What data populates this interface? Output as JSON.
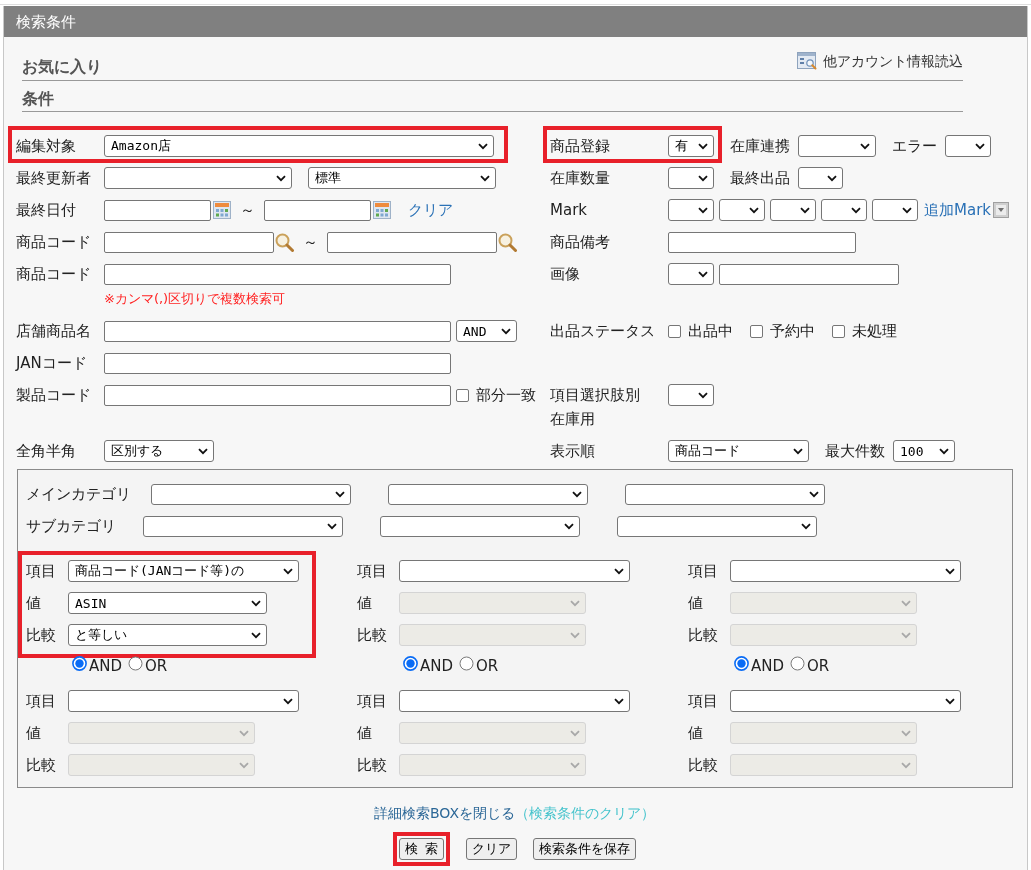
{
  "header": {
    "title": "検索条件"
  },
  "favorites": {
    "heading": "お気に入り",
    "link": "他アカウント情報読込"
  },
  "conditions": {
    "heading": "条件"
  },
  "form_rows": [
    {
      "left": [
        {
          "label": "編集対象",
          "highlighted": true,
          "controls": [
            {
              "kind": "select",
              "value": "Amazon店"
            }
          ]
        }
      ],
      "right": [
        {
          "label": "商品登録",
          "highlighted": true,
          "controls": [
            {
              "kind": "select",
              "value": "有"
            }
          ]
        },
        {
          "label": "在庫連携",
          "highlighted": false,
          "controls": [
            {
              "kind": "select"
            }
          ]
        },
        {
          "label": "エラー",
          "highlighted": false,
          "controls": [
            {
              "kind": "select"
            }
          ]
        }
      ]
    },
    {
      "left": [
        {
          "label": "最終更新者",
          "highlighted": false,
          "controls": [
            {
              "kind": "select"
            },
            {
              "kind": "select",
              "value": "標準"
            }
          ]
        }
      ],
      "right": [
        {
          "label": "在庫数量",
          "highlighted": false,
          "controls": [
            {
              "kind": "select"
            }
          ]
        },
        {
          "label": "最終出品",
          "highlighted": false,
          "controls": [
            {
              "kind": "select"
            }
          ]
        }
      ]
    },
    {
      "left": [
        {
          "label": "最終日付",
          "highlighted": false,
          "controls": [
            {
              "kind": "date"
            },
            {
              "kind": "text",
              "text": "～"
            },
            {
              "kind": "date"
            },
            {
              "kind": "link",
              "text": "クリア"
            }
          ]
        }
      ],
      "right": [
        {
          "label": "Mark",
          "highlighted": false,
          "controls": [
            {
              "kind": "select"
            },
            {
              "kind": "select"
            },
            {
              "kind": "select"
            },
            {
              "kind": "select"
            },
            {
              "kind": "select"
            },
            {
              "kind": "menu_link",
              "text": "追加Mark"
            }
          ]
        }
      ]
    },
    {
      "left": [
        {
          "label": "商品コード",
          "highlighted": false,
          "controls": [
            {
              "kind": "lookup"
            },
            {
              "kind": "text",
              "text": "～"
            },
            {
              "kind": "lookup"
            }
          ]
        }
      ],
      "right": [
        {
          "label": "商品備考",
          "highlighted": false,
          "controls": [
            {
              "kind": "input"
            }
          ]
        }
      ]
    },
    {
      "left": [
        {
          "label": "商品コード",
          "highlighted": false,
          "controls": [
            {
              "kind": "input"
            }
          ],
          "note": "※カンマ(,)区切りで複数検索可"
        }
      ],
      "right": [
        {
          "label": "画像",
          "highlighted": false,
          "controls": [
            {
              "kind": "select"
            },
            {
              "kind": "input"
            }
          ]
        }
      ]
    },
    {
      "left": [
        {
          "label": "店舗商品名",
          "highlighted": false,
          "controls": [
            {
              "kind": "input"
            },
            {
              "kind": "select",
              "value": "AND"
            }
          ]
        }
      ],
      "right": [
        {
          "label": "出品ステータス",
          "highlighted": false,
          "controls": [
            {
              "kind": "checkbox",
              "label": "出品中",
              "checked": false
            },
            {
              "kind": "checkbox",
              "label": "予約中",
              "checked": false
            },
            {
              "kind": "checkbox",
              "label": "未処理",
              "checked": false
            }
          ]
        }
      ]
    },
    {
      "left": [
        {
          "label": "JANコード",
          "highlighted": false,
          "controls": [
            {
              "kind": "input"
            }
          ]
        }
      ]
    },
    {
      "left": [
        {
          "label": "製品コード",
          "highlighted": false,
          "controls": [
            {
              "kind": "input"
            },
            {
              "kind": "checkbox",
              "label": "部分一致",
              "checked": false
            }
          ]
        }
      ],
      "right": [
        {
          "label": "項目選択肢別",
          "label_line_2": "在庫用",
          "highlighted": false,
          "controls": [
            {
              "kind": "select"
            }
          ]
        }
      ]
    },
    {
      "left": [
        {
          "label": "全角半角",
          "highlighted": false,
          "controls": [
            {
              "kind": "select",
              "value": "区別する"
            }
          ]
        }
      ],
      "right": [
        {
          "label": "表示順",
          "highlighted": false,
          "controls": [
            {
              "kind": "select",
              "value": "商品コード"
            }
          ]
        },
        {
          "label": "最大件数",
          "highlighted": false,
          "controls": [
            {
              "kind": "select",
              "value": "100"
            }
          ]
        }
      ]
    }
  ],
  "category_box": {
    "rows": [
      {
        "label": "メインカテゴリ",
        "selects": [
          {
            "disabled": false
          },
          {
            "disabled": false
          },
          {
            "disabled": false
          }
        ]
      },
      {
        "label": "サブカテゴリ",
        "selects": [
          {
            "disabled": false
          },
          {
            "disabled": false
          },
          {
            "disabled": false
          }
        ]
      }
    ],
    "condition_groups": [
      {
        "highlighted": true,
        "fields": [
          {
            "label": "項目",
            "value": "商品コード(JANコード等)の",
            "disabled": false
          },
          {
            "label": "値",
            "value": "ASIN",
            "disabled": false
          },
          {
            "label": "比較",
            "value": "と等しい",
            "disabled": false
          }
        ],
        "connector": [
          {
            "label": "AND",
            "selected": true
          },
          {
            "label": "OR",
            "selected": false
          }
        ]
      },
      {
        "highlighted": false,
        "fields": [
          {
            "label": "項目",
            "disabled": false
          },
          {
            "label": "値",
            "disabled": true
          },
          {
            "label": "比較",
            "disabled": true
          }
        ],
        "connector": [
          {
            "label": "AND",
            "selected": true
          },
          {
            "label": "OR",
            "selected": false
          }
        ]
      },
      {
        "highlighted": false,
        "fields": [
          {
            "label": "項目",
            "disabled": false
          },
          {
            "label": "値",
            "disabled": true
          },
          {
            "label": "比較",
            "disabled": true
          }
        ],
        "connector": [
          {
            "label": "AND",
            "selected": true
          },
          {
            "label": "OR",
            "selected": false
          }
        ]
      },
      {
        "highlighted": false,
        "fields": [
          {
            "label": "項目",
            "disabled": false
          },
          {
            "label": "値",
            "disabled": true
          },
          {
            "label": "比較",
            "disabled": true
          }
        ]
      },
      {
        "highlighted": false,
        "fields": [
          {
            "label": "項目",
            "disabled": false
          },
          {
            "label": "値",
            "disabled": true
          },
          {
            "label": "比較",
            "disabled": true
          }
        ]
      },
      {
        "highlighted": false,
        "fields": [
          {
            "label": "項目",
            "disabled": false
          },
          {
            "label": "値",
            "disabled": true
          },
          {
            "label": "比較",
            "disabled": true
          }
        ]
      }
    ]
  },
  "footer_links": [
    "詳細検索BOXを閉じる",
    "（検索条件のクリア）"
  ],
  "buttons": [
    {
      "label": "検 索",
      "highlighted": true
    },
    {
      "label": "クリア",
      "highlighted": false
    },
    {
      "label": "検索条件を保存",
      "highlighted": false
    }
  ]
}
